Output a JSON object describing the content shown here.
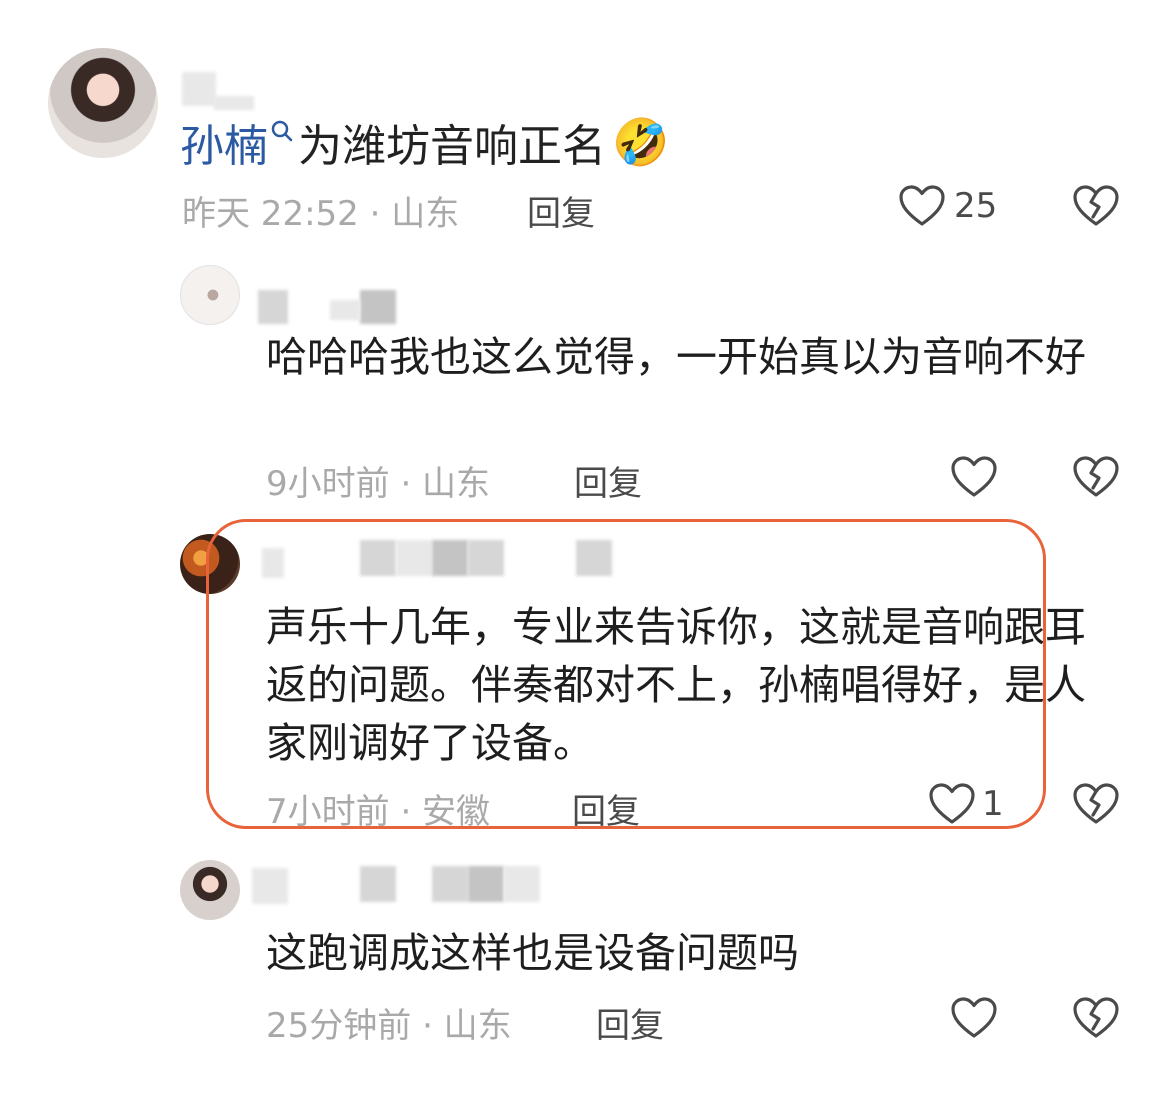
{
  "comment": {
    "mention": "孙楠",
    "text": "为潍坊音响正名",
    "emoji": "🤣",
    "meta": "昨天 22:52 · 山东",
    "reply_label": "回复",
    "like_count": "25"
  },
  "replies": [
    {
      "text": "哈哈哈我也这么觉得，一开始真以为音响不好",
      "meta": "9小时前 · 山东",
      "reply_label": "回复",
      "like_count": ""
    },
    {
      "text": "声乐十几年，专业来告诉你，这就是音响跟耳返的问题。伴奏都对不上，孙楠唱得好，是人家刚调好了设备。",
      "meta": "7小时前 · 安徽",
      "reply_label": "回复",
      "like_count": "1"
    },
    {
      "text": "这跑调成这样也是设备问题吗",
      "meta": "25分钟前 · 山东",
      "reply_label": "回复",
      "like_count": ""
    }
  ],
  "icons": {
    "like": "heart-outline-icon",
    "dislike": "broken-heart-icon",
    "search": "search-icon"
  },
  "colors": {
    "mention": "#2b5aa3",
    "highlight": "#e8623a",
    "meta": "#a9a9a9"
  }
}
